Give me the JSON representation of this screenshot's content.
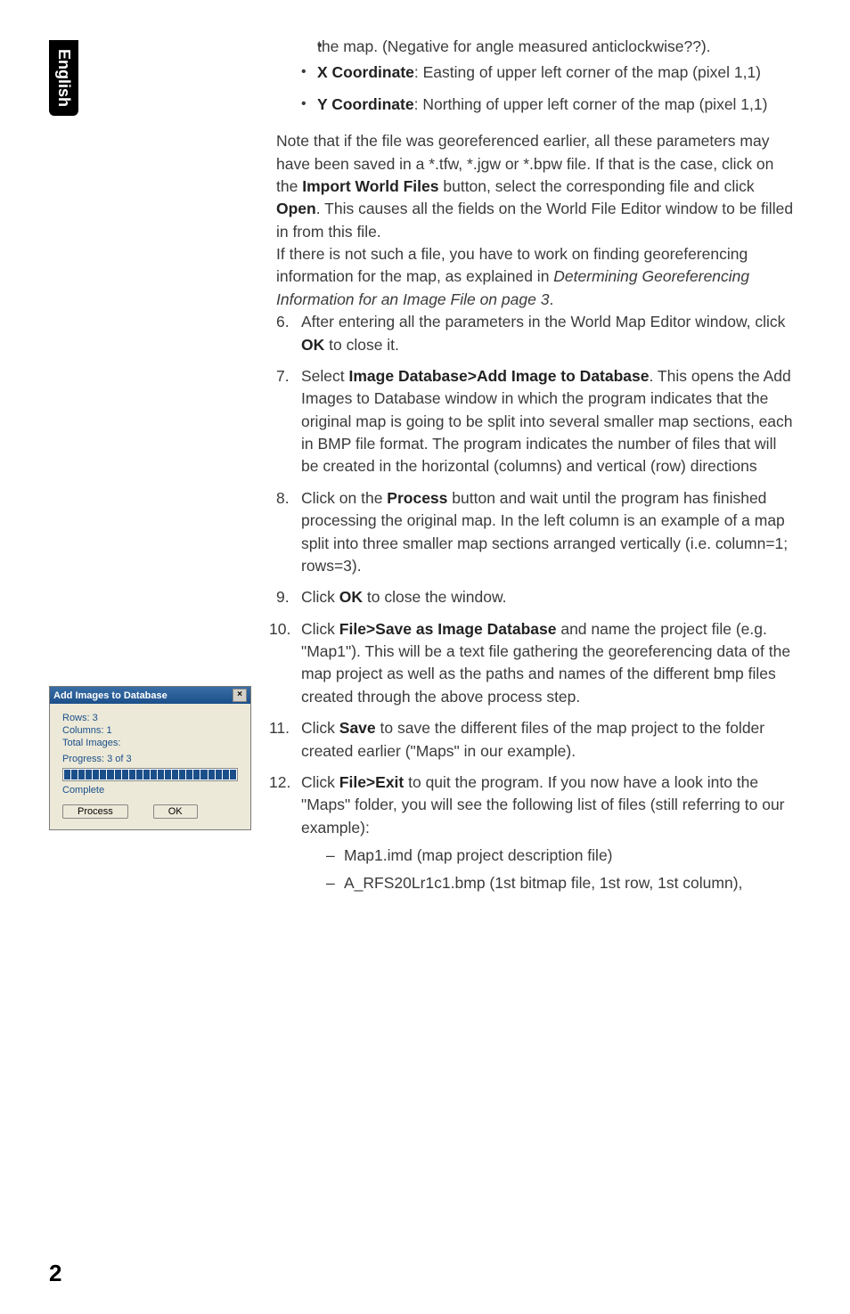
{
  "side_tab": "English",
  "bullets_top": [
    {
      "prefix": "",
      "text": "the map. (Negative for angle measured anticlockwise??)."
    },
    {
      "prefix": "X Coordinate",
      "text": ": Easting of upper left corner of the map (pixel 1,1)"
    },
    {
      "prefix": "Y Coordinate",
      "text": ": Northing of upper left corner of the map (pixel 1,1)"
    }
  ],
  "note1_a": "Note that if the file was georeferenced earlier, all these parameters may have been saved in a *.tfw, *.jgw or *.bpw file. If that is the case, click on the ",
  "note1_bold1": "Import World Files",
  "note1_b": " button, select the corresponding file and click ",
  "note1_bold2": "Open",
  "note1_c": ". This causes all the fields on the World File Editor window to be filled in from this file.",
  "note2_a": "If there is not such a file, you have to work on finding georeferencing information for the map, as explained in ",
  "note2_ital": "Determining Georeferencing Information for an Image File on page 3",
  "note2_b": ".",
  "num6": "6.",
  "li6_a": "After entering all the parameters in the World Map Editor window, click ",
  "li6_ok": "OK",
  "li6_b": " to close it.",
  "num7": "7.",
  "li7_a": "Select ",
  "li7_bold": "Image Database>Add Image to Database",
  "li7_b": ". This opens the Add Images to Database window in which the program indicates that the original map is going to be split into several smaller map sections, each in BMP file format. The program indicates the number of files that will be created in the horizontal (columns) and vertical (row) directions",
  "num8": "8.",
  "li8_a": "Click on the ",
  "li8_bold": "Process",
  "li8_b": " button and wait until the program has finished processing the original map. In the left column is an example of a map split into three smaller map sections arranged vertically (i.e. column=1; rows=3).",
  "num9": "9.",
  "li9_a": "Click ",
  "li9_ok": "OK",
  "li9_b": " to close the window.",
  "num10": "10.",
  "li10_a": "Click ",
  "li10_bold": "File>Save as Image Database",
  "li10_b": " and name the project file (e.g. \"Map1\"). This will be a text file gathering the georeferencing data of the map project as well as the paths and names of the different bmp files created through the above process step.",
  "num11": "11.",
  "li11_a": "Click ",
  "li11_bold": "Save",
  "li11_b": " to save the different files of the map project to the folder created earlier (\"Maps\" in our example).",
  "num12": "12.",
  "li12_a": "Click ",
  "li12_bold": "File>Exit",
  "li12_b": " to quit the program. If you now have a look into the \"Maps\" folder, you will see the following list of files (still referring to our example):",
  "dash1": "Map1.imd (map project description file)",
  "dash2": "A_RFS20Lr1c1.bmp (1st bitmap file, 1st row, 1st column),",
  "dialog": {
    "title": "Add Images to Database",
    "rows_label": "Rows: 3",
    "cols_label": "Columns: 1",
    "total_label": "Total Images:",
    "progress_label": "Progress: 3 of 3",
    "complete_label": "Complete",
    "process_btn": "Process",
    "ok_btn": "OK"
  },
  "page_number": "2"
}
